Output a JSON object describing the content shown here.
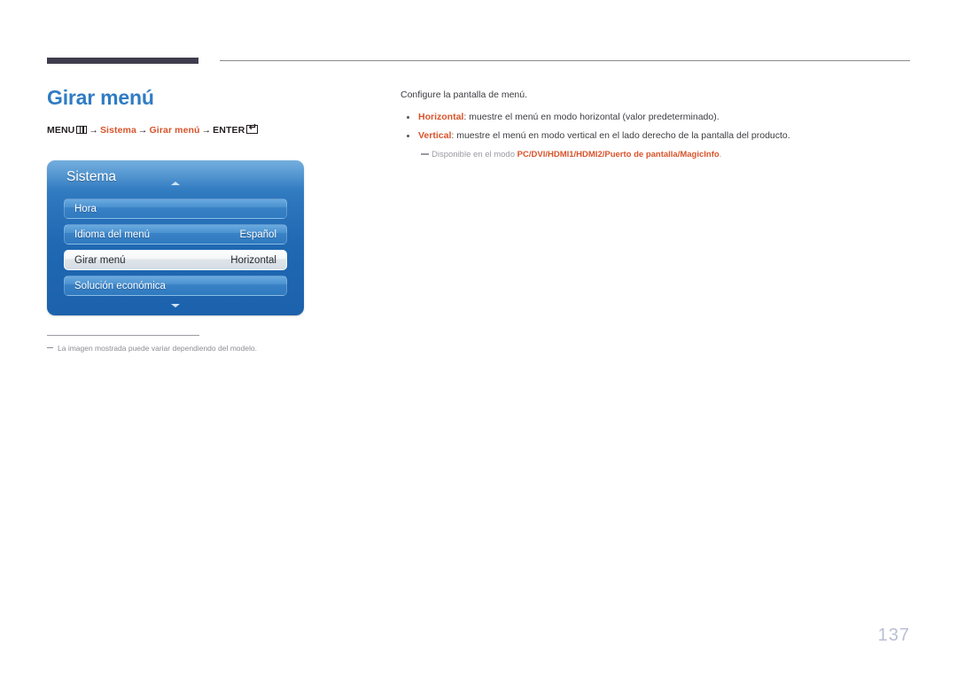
{
  "header": {
    "rule_dark_color": "#3f3d4d",
    "rule_thin_color": "#8a8a8a"
  },
  "left": {
    "title": "Girar menú",
    "title_color": "#2f7cc3",
    "breadcrumb": {
      "menu_label": "MENU",
      "menu_icon": "menu-bars-icon",
      "arrow1": "→",
      "item1": "Sistema",
      "arrow2": "→",
      "item2": "Girar menú",
      "arrow3": "→",
      "enter_label": "ENTER",
      "enter_icon": "enter-key-icon",
      "accent_color": "#d8542b"
    },
    "osd": {
      "title": "Sistema",
      "scroll_up_icon": "triangle-up-icon",
      "scroll_down_icon": "triangle-down-icon",
      "rows": [
        {
          "label": "Hora",
          "value": "",
          "selected": false
        },
        {
          "label": "Idioma del menú",
          "value": "Español",
          "selected": false
        },
        {
          "label": "Girar menú",
          "value": "Horizontal",
          "selected": true
        },
        {
          "label": "Solución económica",
          "value": "",
          "selected": false
        }
      ]
    },
    "note": "La imagen mostrada puede variar dependiendo del modelo."
  },
  "right": {
    "intro": "Configure la pantalla de menú.",
    "bullets": [
      {
        "term": "Horizontal",
        "rest": ": muestre el menú en modo horizontal (valor predeterminado)."
      },
      {
        "term": "Vertical",
        "rest": ": muestre el menú en modo vertical en el lado derecho de la pantalla del producto."
      }
    ],
    "subnote": {
      "prefix": "Disponible en el modo ",
      "modes": "PC/DVI/HDMI1/HDMI2/Puerto de pantalla/MagicInfo",
      "suffix": "."
    }
  },
  "footer": {
    "page_number": "137",
    "page_number_color": "#b9bfd4"
  }
}
